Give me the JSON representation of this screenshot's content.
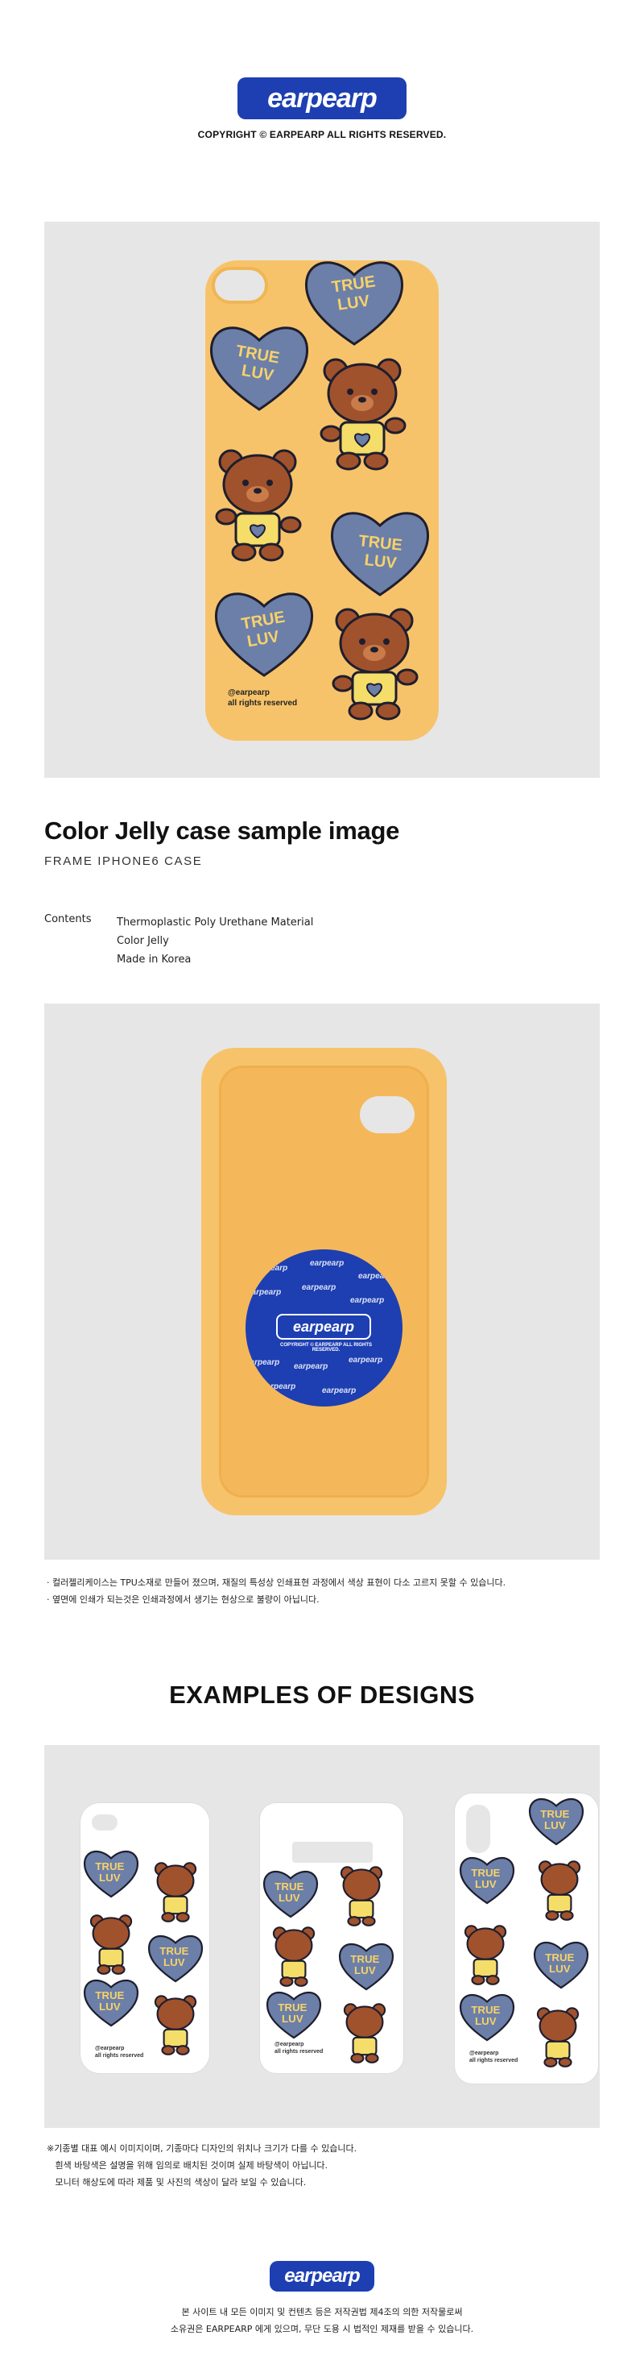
{
  "brand": {
    "logo_text": "earpearp",
    "brand_color": "#1d3fb2"
  },
  "copyright": "COPYRIGHT © EARPEARP ALL RIGHTS RESERVED.",
  "product": {
    "case_color": "#f7c36a",
    "heart_color": "#6b7fa8",
    "heart_text_color": "#f7d26a",
    "heart_text": [
      "TRUE",
      "LUV"
    ],
    "credit_lines": [
      "@earpearp",
      "all rights reserved"
    ]
  },
  "title": "Color Jelly case sample image",
  "subtitle": "FRAME IPHONE6 CASE",
  "specs": {
    "label": "Contents",
    "values": [
      "Thermoplastic Poly Urethane Material",
      "Color Jelly",
      "Made in Korea"
    ]
  },
  "back_badge": {
    "logo_text": "earpearp",
    "copy_text": "COPYRIGHT © EARPEARP ALL RIGHTS RESERVED.",
    "pattern_text": "earpearp"
  },
  "notes_primary": [
    "· 컬러젤리케이스는 TPU소재로 만들어 졌으며, 재질의 특성상 인쇄표현 과정에서 색상 표현이 다소 고르지 못할 수 있습니다.",
    "· 옆면에 인쇄가 되는것은 인쇄과정에서 생기는 현상으로 불량이 아닙니다."
  ],
  "examples_title": "EXAMPLES OF DESIGNS",
  "notes_examples": [
    "※기종별 대표 예시 이미지이며, 기종마다 디자인의 위치나 크기가 다를 수 있습니다.",
    "   흰색 바탕색은 설명을 위해 임의로 배치된 것이며 실제 바탕색이 아닙니다.",
    "   모니터 해상도에 따라 제품 및 사진의 색상이 달라 보일 수 있습니다."
  ],
  "footer": [
    "본 사이트 내 모든 이미지 및 컨텐츠 등은 저작권법 제4조의 의한 저작물로써",
    "소유권은 EARPEARP 에게 있으며, 무단 도용 시 법적인 제재를 받을 수 있습니다."
  ]
}
